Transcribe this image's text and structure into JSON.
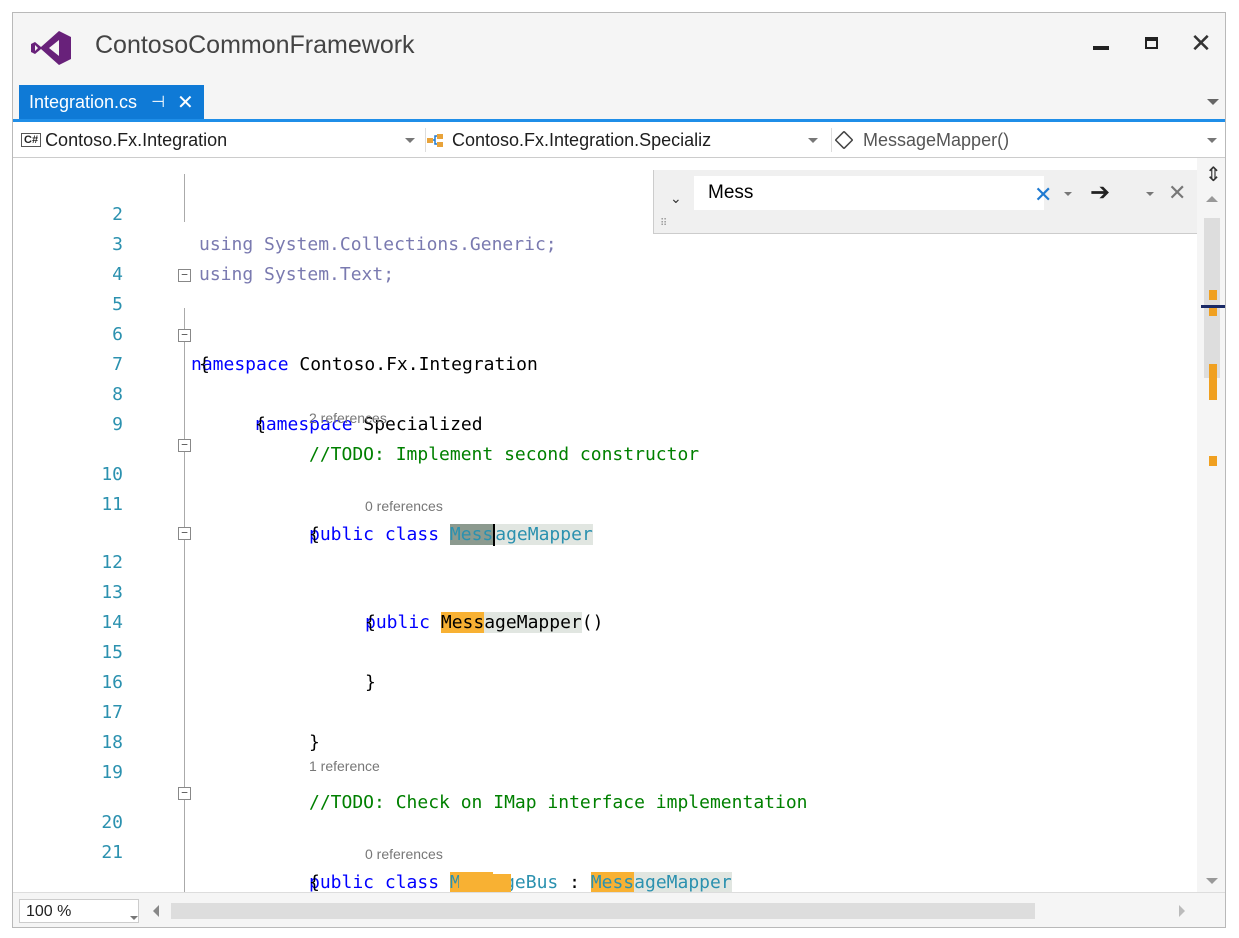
{
  "window": {
    "title": "ContosoCommonFramework"
  },
  "tab": {
    "label": "Integration.cs",
    "pin": "⊣",
    "close": "✕"
  },
  "nav": {
    "project_icon": "C#",
    "project": "Contoso.Fx.Integration",
    "type": "Contoso.Fx.Integration.Specializ",
    "member": "MessageMapper()"
  },
  "find": {
    "value": "Mess",
    "clear": "✕",
    "next": "➔",
    "close": "✕",
    "toggle": "⌄",
    "grip": "⠿"
  },
  "editor": {
    "lines": {
      "l2": {
        "num": "2",
        "text": "using System.Collections.Generic;"
      },
      "l3": {
        "num": "3",
        "text": "using System.Text;"
      },
      "l4": {
        "num": "4"
      },
      "l5": {
        "num": "5",
        "kw": "namespace",
        "rest": " Contoso.Fx.Integration"
      },
      "l6": {
        "num": "6",
        "text": "{"
      },
      "l7": {
        "num": "7",
        "kw": "namespace",
        "rest": " Specialized"
      },
      "l8": {
        "num": "8",
        "text": "{"
      },
      "l9": {
        "num": "9",
        "text": "//TODO: Implement second constructor"
      },
      "r1": "2 references",
      "l10": {
        "num": "10",
        "kw": "public class ",
        "hl": "Mess",
        "rest": "ageMapper"
      },
      "l11": {
        "num": "11",
        "text": "{"
      },
      "r2": "0 references",
      "l12": {
        "num": "12",
        "kw": "public ",
        "hl": "Mess",
        "rest": "ageMapper",
        "tail": "()"
      },
      "l13": {
        "num": "13",
        "text": "{"
      },
      "l14": {
        "num": "14"
      },
      "l15": {
        "num": "15",
        "text": "}"
      },
      "l16": {
        "num": "16"
      },
      "l17": {
        "num": "17",
        "text": "}"
      },
      "l18": {
        "num": "18"
      },
      "l19": {
        "num": "19",
        "text": "//TODO: Check on IMap interface implementation"
      },
      "r3": "1 reference",
      "l20": {
        "num": "20",
        "kw": "public class ",
        "hl": "Mess",
        "rest": "ageBus",
        "sep": " : ",
        "hl2": "Mess",
        "rest2": "ageMapper"
      },
      "l21": {
        "num": "21",
        "text": "{"
      },
      "r4": "0 references"
    }
  },
  "status": {
    "zoom": "100 %"
  },
  "colors": {
    "accent": "#1f8ee8",
    "tab": "#0f7ad6",
    "find_highlight": "#f8b133",
    "keyword": "#0000ff",
    "type": "#2b91af",
    "comment": "#008000"
  }
}
